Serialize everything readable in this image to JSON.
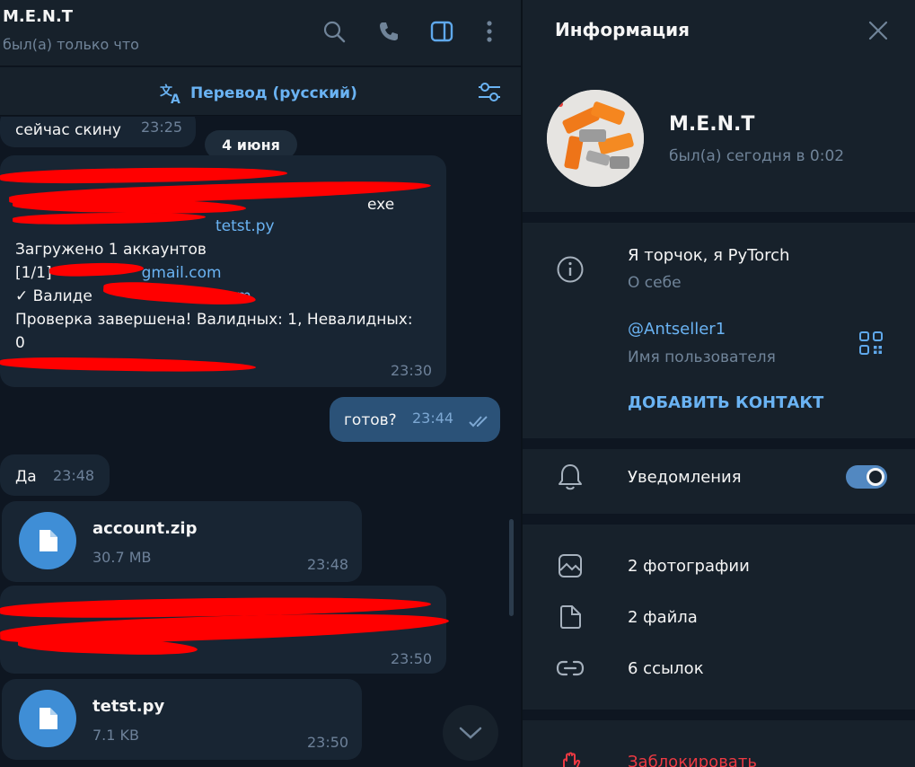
{
  "chat": {
    "title": "M.E.N.T",
    "status": "был(а) только что",
    "header_icons": [
      "search-icon",
      "phone-icon",
      "sidebar-toggle-icon",
      "more-vertical-icon"
    ],
    "translate_label": "Перевод (русский)",
    "date_badge": "4 июня",
    "messages": {
      "m1": {
        "text": "сейчас скину",
        "time": "23:25"
      },
      "m2": {
        "line1": "Загружено 1 аккаунтов",
        "line2_prefix": "[1/1]",
        "line2_link": "gmail.com",
        "line3_prefix": "✓ Валиде",
        "line3_link": "om",
        "line4": "Проверка завершена! Валидных: 1, Невалидных:",
        "line5": "0",
        "partial1": "exe",
        "partial2": "tetst.py",
        "time": "23:30"
      },
      "m3": {
        "text": "готов?",
        "time": "23:44"
      },
      "m4": {
        "text": "Да",
        "time": "23:48"
      },
      "m5": {
        "file_name": "account.zip",
        "file_size": "30.7 MB",
        "time": "23:48"
      },
      "m6": {
        "time": "23:50"
      },
      "m7": {
        "file_name": "tetst.py",
        "file_size": "7.1 KB",
        "time": "23:50"
      }
    }
  },
  "info": {
    "title": "Информация",
    "contact_name": "M.E.N.T",
    "contact_status": "был(а) сегодня в 0:02",
    "bio": "Я торчок, я PyTorch",
    "bio_label": "О себе",
    "username": "@Antseller1",
    "username_label": "Имя пользователя",
    "add_contact": "ДОБАВИТЬ КОНТАКТ",
    "notifications": "Уведомления",
    "notifications_on": true,
    "photos": "2 фотографии",
    "files": "2 файла",
    "links": "6 ссылок",
    "block": "Заблокировать"
  },
  "colors": {
    "accent": "#6ab3f3",
    "bubble_in": "#182533",
    "bubble_out": "#2b5278",
    "panel": "#17212b",
    "background": "#0e1621",
    "danger": "#ec3942",
    "redaction": "#ff0000"
  }
}
